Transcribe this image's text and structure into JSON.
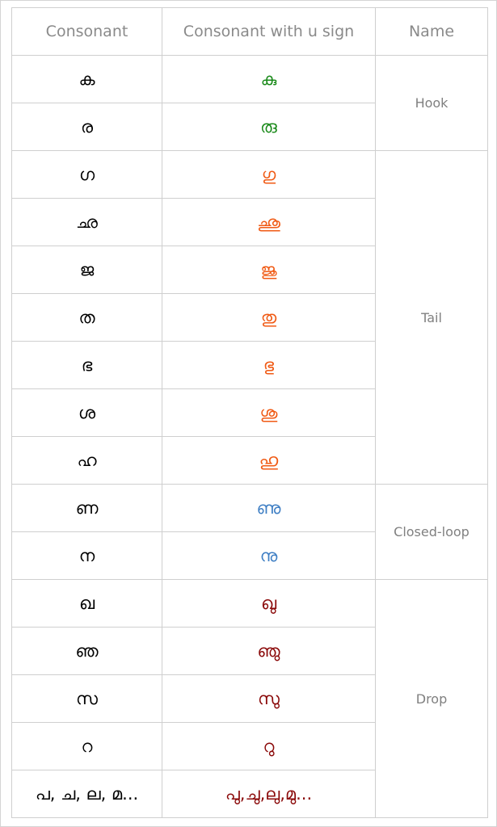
{
  "table": {
    "headers": [
      "Consonant",
      "Consonant with u sign",
      "Name"
    ],
    "groups": [
      {
        "name": "Hook",
        "color": "#1a8a1a",
        "rows": [
          {
            "consonant": "ക",
            "with_u": "കു"
          },
          {
            "consonant": "ര",
            "with_u": "രു"
          }
        ]
      },
      {
        "name": "Tail",
        "color": "#f05a14",
        "rows": [
          {
            "consonant": "ഗ",
            "with_u": "ഗു"
          },
          {
            "consonant": "ഛ",
            "with_u": "ഛു"
          },
          {
            "consonant": "ജ",
            "with_u": "ജു"
          },
          {
            "consonant": "ത",
            "with_u": "തു"
          },
          {
            "consonant": "ഭ",
            "with_u": "ഭു"
          },
          {
            "consonant": "ശ",
            "with_u": "ശു"
          },
          {
            "consonant": "ഹ",
            "with_u": "ഹു"
          }
        ]
      },
      {
        "name": "Closed-loop",
        "color": "#3f7fc4",
        "rows": [
          {
            "consonant": "ണ",
            "with_u": "ണു"
          },
          {
            "consonant": "ന",
            "with_u": "നു"
          }
        ]
      },
      {
        "name": "Drop",
        "color": "#8b0a0a",
        "rows": [
          {
            "consonant": "ഖ",
            "with_u": "ഖു"
          },
          {
            "consonant": "ഞ",
            "with_u": "ഞു"
          },
          {
            "consonant": "സ",
            "with_u": "സു"
          },
          {
            "consonant": "റ",
            "with_u": "റു"
          },
          {
            "consonant": "പ, ച, ല, മ...",
            "with_u": "പു,ചു,ലു,മു..."
          }
        ]
      }
    ]
  }
}
